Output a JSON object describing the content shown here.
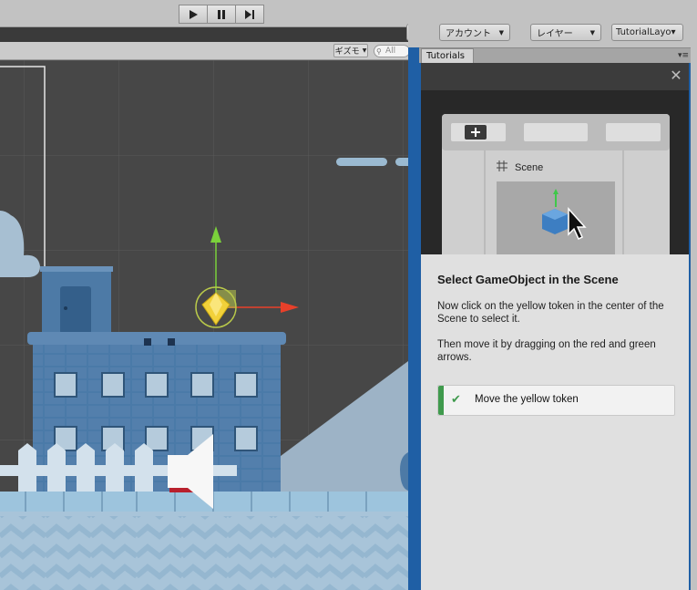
{
  "toolbar": {
    "account_label": "アカウント",
    "layers_label": "レイヤー",
    "layout_label": "TutorialLayo▾"
  },
  "scene": {
    "gizmos_label": "ギズモ",
    "search_placeholder": "All"
  },
  "tutorial": {
    "tab_label": "Tutorials",
    "illustration_label": "Scene",
    "title": "Select GameObject in the Scene",
    "paragraph1": "Now click on the yellow token in the center of the Scene to select it.",
    "paragraph2": "Then move it by dragging on the red and green arrows.",
    "task_label": "Move the yellow token"
  },
  "colors": {
    "accent_blue": "#1f5fa5",
    "task_green": "#3f9a4d",
    "gizmo_red": "#e8402a",
    "gizmo_green": "#7bd13b",
    "token_yellow": "#f2d13a"
  }
}
